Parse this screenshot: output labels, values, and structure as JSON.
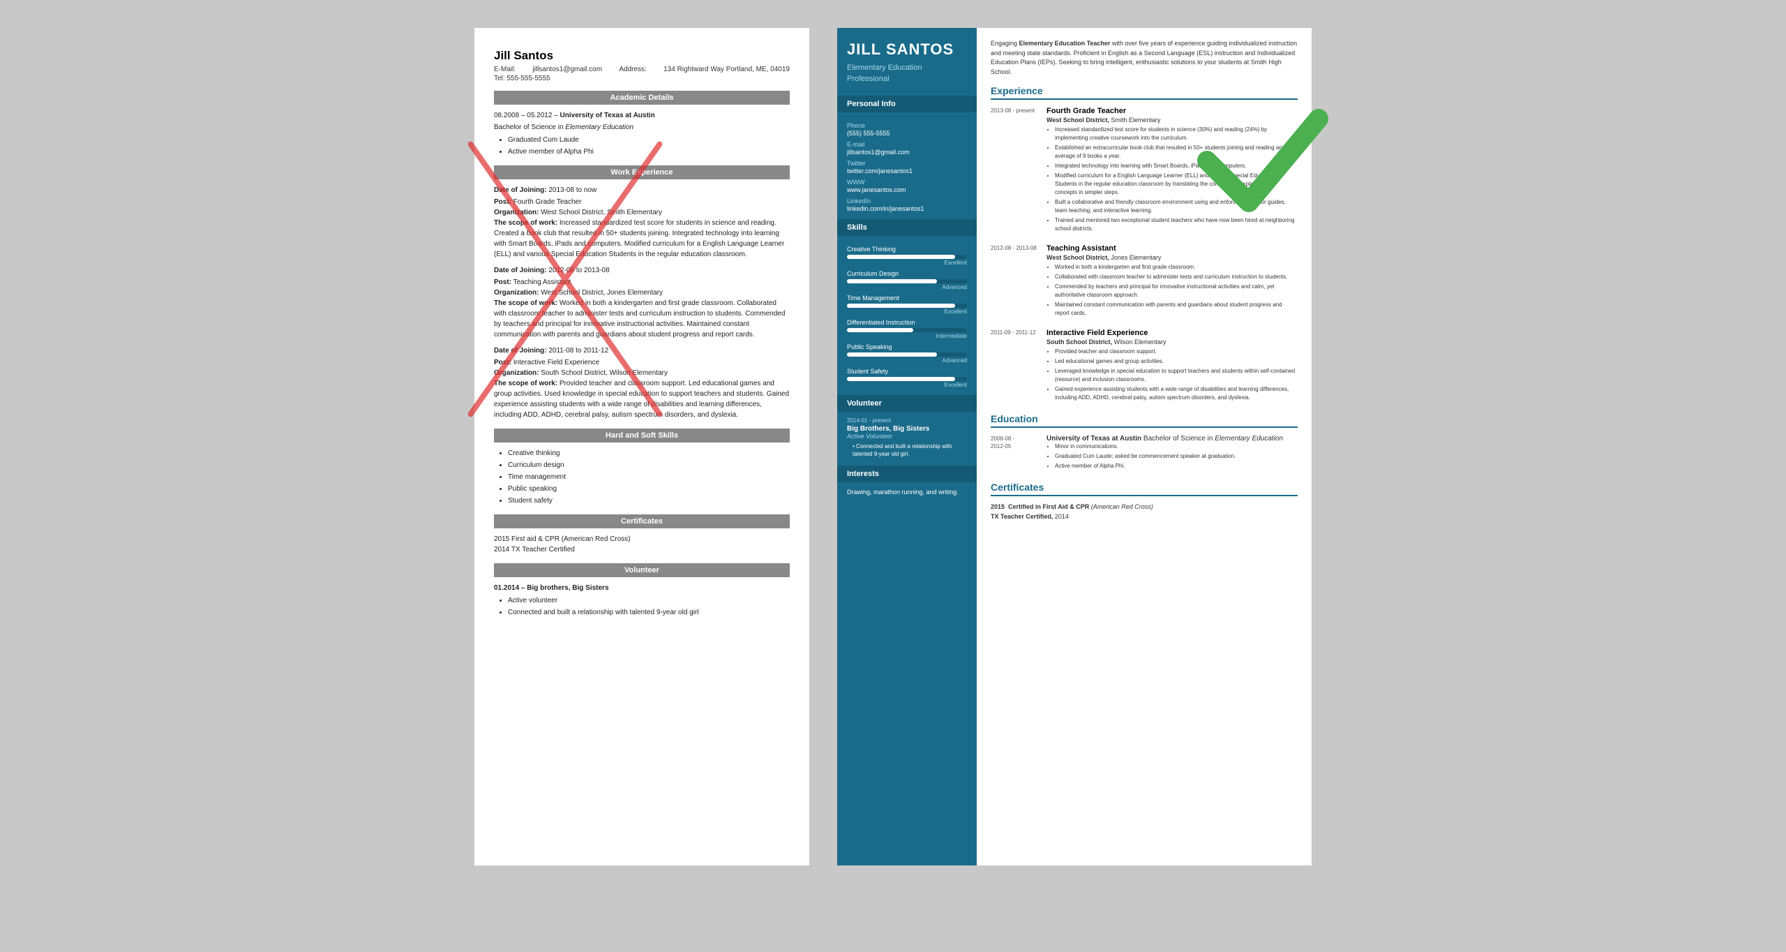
{
  "left": {
    "name": "Jill Santos",
    "email_label": "E-Mail:",
    "email": "jillsantos1@gmail.com",
    "address_label": "Address:",
    "address": "134 Rightward Way Portland, ME, 04019",
    "phone_label": "Tel:",
    "phone": "555-555-5555",
    "sections": {
      "academic_title": "Academic Details",
      "academic_date": "08.2008 – 05.2012 –",
      "academic_uni": "University of Texas at Austin",
      "academic_degree": "Bachelor of Science in Elementary Education",
      "academic_bullets": [
        "Graduated Cum Laude",
        "Active member of Alpha Phi"
      ],
      "work_title": "Work Experience",
      "work_items": [
        {
          "date": "Date of Joining: 2013-08 to now",
          "post": "Fourth Grade Teacher",
          "org": "West School District, Smith Elementary",
          "scope": "Increased standardized test score for students in science and reading. Created a book club that resulted in 50+ students joining. Integrated technology into learning with Smart Boards, iPads and computers. Modified curriculum for a English Language Learner (ELL) and various Special Education Students in the regular education classroom."
        },
        {
          "date": "Date of Joining: 2012-08 to 2013-08",
          "post": "Teaching Assistant",
          "org": "West School District, Jones Elementary",
          "scope": "Worked in both a kindergarten and first grade classroom. Collaborated with classroom teacher to administer tests and curriculum instruction to students. Commended by teachers and principal for innovative instructional activities. Maintained constant communication with parents and guardians about student progress and report cards."
        },
        {
          "date": "Date of Joining: 2011-08 to 2011-12",
          "post": "Interactive Field Experience",
          "org": "South School District, Wilson Elementary",
          "scope": "Provided teacher and classroom support. Led educational games and group activities. Used knowledge in special education to support teachers and students. Gained experience assisting students with a wide range of disabilities and learning differences, including ADD, ADHD, cerebral palsy, autism spectrum disorders, and dyslexia."
        }
      ],
      "skills_title": "Hard and Soft Skills",
      "skills": [
        "Creative thinking",
        "Curriculum design",
        "Time management",
        "Public speaking",
        "Student safety"
      ],
      "certs_title": "Certificates",
      "certs": [
        "2015 First aid & CPR (American Red Cross)",
        "2014 TX Teacher Certified"
      ],
      "volunteer_title": "Volunteer",
      "volunteer_date": "01.2014 – Big brothers, Big Sisters",
      "volunteer_bullets": [
        "Active volunteer",
        "Connected and built a relationship with talented 9-year old girl"
      ]
    }
  },
  "right": {
    "name": "JILL SANTOS",
    "title_line1": "Elementary Education",
    "title_line2": "Professional",
    "summary": "Engaging Elementary Education Teacher with over five years of experience guiding individualized instruction and meeting state standards. Proficient in English as a Second Language (ESL) instruction and Individualized Education Plans (IEPs). Seeking to bring intelligent, enthusiastic solutions to your students at Smith High School.",
    "sidebar": {
      "personal_info_title": "Personal Info",
      "phone_label": "Phone",
      "phone": "(555) 555-5555",
      "email_label": "E-mail",
      "email": "jillsantos1@gmail.com",
      "twitter_label": "Twitter",
      "twitter": "twitter.com/janesantos1",
      "www_label": "WWW",
      "www": "www.janesantos.com",
      "linkedin_label": "LinkedIn",
      "linkedin": "linkedin.com/in/janesantos1",
      "skills_title": "Skills",
      "skills": [
        {
          "name": "Creative Thinking",
          "level": "Excellent",
          "pct": 90
        },
        {
          "name": "Curriculum Design",
          "level": "Advanced",
          "pct": 75
        },
        {
          "name": "Time Management",
          "level": "Excellent",
          "pct": 90
        },
        {
          "name": "Differentiated Instruction",
          "level": "Intermediate",
          "pct": 55
        },
        {
          "name": "Public Speaking",
          "level": "Advanced",
          "pct": 75
        },
        {
          "name": "Student Safety",
          "level": "Excellent",
          "pct": 90
        }
      ],
      "volunteer_title": "Volunteer",
      "volunteer_date": "2014-01 - present",
      "volunteer_org": "Big Brothers, Big Sisters",
      "volunteer_role": "Active Volunteer",
      "volunteer_bullets": [
        "Connected and built a relationship with talented 9-year old girl."
      ],
      "interests_title": "Interests",
      "interests_text": "Drawing, marathon running, and writing."
    },
    "experience_title": "Experience",
    "experience": [
      {
        "date": "2013-08 - present",
        "title": "Fourth Grade Teacher",
        "org_bold": "West School District,",
        "org_rest": " Smith Elementary",
        "bullets": [
          "Increased standardized test score for students in science (30%) and reading (24%) by implementing creative coursework into the curriculum.",
          "Established an extracurricular book club that resulted in 50+ students joining and reading an average of 9 books a year.",
          "Integrated technology into learning with Smart Boards, iPads, and computers.",
          "Modified curriculum for a English Language Learner (ELL) and various Special Education Students in the regular education classroom by translating the concepts or explaining the concepts in simpler steps.",
          "Built a collaborative and friendly classroom environment using and enforcing behavior guides, team teaching, and interactive learning.",
          "Trained and mentored two exceptional student teachers who have now been hired at neighboring school districts."
        ]
      },
      {
        "date": "2012-08 - 2013-08",
        "title": "Teaching Assistant",
        "org_bold": "West School District,",
        "org_rest": " Jones Elementary",
        "bullets": [
          "Worked in both a kindergarten and first grade classroom.",
          "Collaborated with classroom teacher to administer tests and curriculum instruction to students.",
          "Commended by teachers and principal for innovative instructional activities and calm, yet authoritative classroom approach.",
          "Maintained constant communication with parents and guardians about student progress and report cards."
        ]
      },
      {
        "date": "2011-09 - 2011-12",
        "title": "Interactive Field Experience",
        "org_bold": "South School District,",
        "org_rest": " Wilson Elementary",
        "bullets": [
          "Provided teacher and classroom support.",
          "Led educational games and group activities.",
          "Leveraged knowledge in special education to support teachers and students within self-contained (resource) and inclusion classrooms.",
          "Gained experience assisting students with a wide range of disabilities and learning differences, including ADD, ADHD, cerebral palsy, autism spectrum disorders, and dyslexia."
        ]
      }
    ],
    "education_title": "Education",
    "education": [
      {
        "date": "2008-08 - 2012-05",
        "uni": "University of Texas at Austin",
        "degree": "Bachelor of Science",
        "degree_rest": " in ",
        "field": "Elementary Education",
        "bullets": [
          "Minor in communications.",
          "Graduated Cum Laude; asked be commencement speaker at graduation.",
          "Active member of Alpha Phi."
        ]
      }
    ],
    "certificates_title": "Certificates",
    "certificates": [
      {
        "year": "2015",
        "label": "Certified in First Aid & CPR",
        "org": "American Red Cross"
      },
      {
        "label": "TX Teacher Certified,",
        "year2": "2014"
      }
    ]
  }
}
